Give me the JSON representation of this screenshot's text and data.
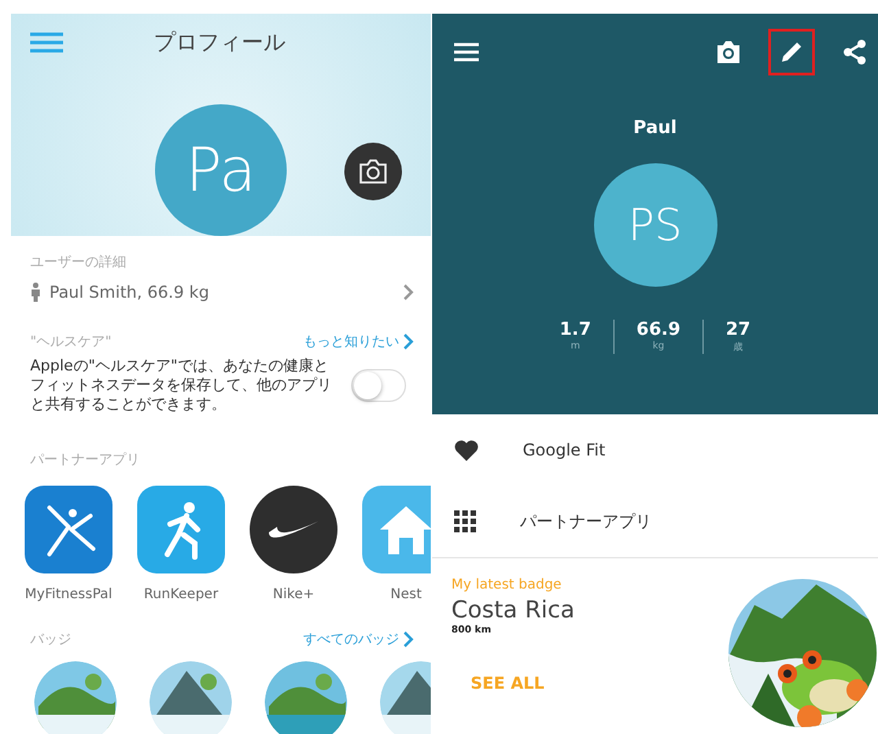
{
  "left": {
    "title": "プロフィール",
    "avatar_initials": "Pa",
    "user_details": {
      "label": "ユーザーの詳細",
      "value": "Paul Smith, 66.9 kg"
    },
    "healthcare": {
      "label": "\"ヘルスケア\"",
      "link": "もっと知りたい",
      "description": "Appleの\"ヘルスケア\"では、あなたの健康とフィットネスデータを保存して、他のアプリと共有することができます。",
      "on": false
    },
    "partner_apps": {
      "label": "パートナーアプリ",
      "apps": [
        {
          "name": "MyFitnessPal",
          "kind": "figure"
        },
        {
          "name": "RunKeeper",
          "kind": "runner"
        },
        {
          "name": "Nike+",
          "kind": "swoosh"
        },
        {
          "name": "Nest",
          "kind": "house"
        }
      ]
    },
    "badges": {
      "label": "バッジ",
      "link": "すべてのバッジ"
    }
  },
  "right": {
    "toolbar": [
      {
        "kind": "camera",
        "highlighted": false
      },
      {
        "kind": "edit",
        "highlighted": true
      },
      {
        "kind": "share",
        "highlighted": false
      }
    ],
    "name": "Paul",
    "avatar_initials": "PS",
    "stats": [
      {
        "value": "1.7",
        "unit": "m"
      },
      {
        "value": "66.9",
        "unit": "kg"
      },
      {
        "value": "27",
        "unit": "歳"
      }
    ],
    "menu": [
      {
        "kind": "heart",
        "label": "Google Fit"
      },
      {
        "kind": "grid",
        "label": "パートナーアプリ"
      }
    ],
    "latest_badge": {
      "label": "My latest badge",
      "title": "Costa Rica",
      "distance": "800 km",
      "action": "SEE ALL"
    }
  }
}
